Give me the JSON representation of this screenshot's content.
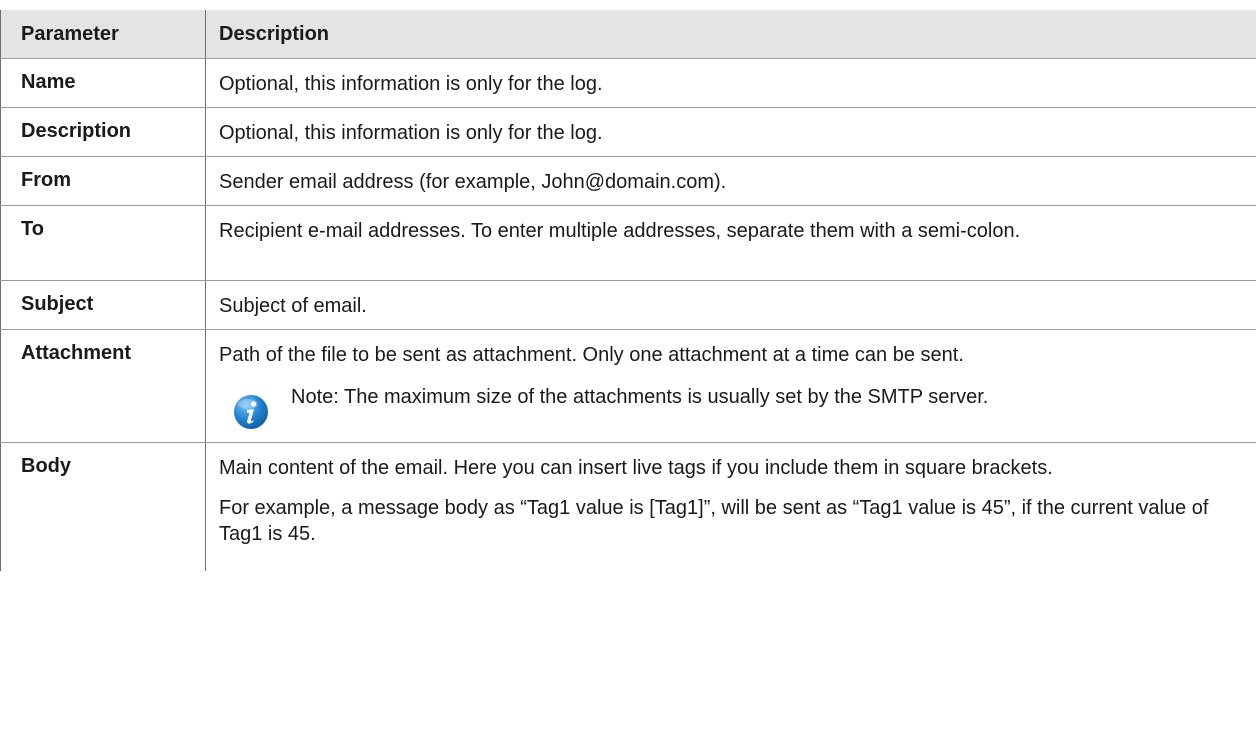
{
  "table": {
    "headers": {
      "parameter": "Parameter",
      "description": "Description"
    },
    "rows": [
      {
        "name": "Name",
        "description": "Optional, this information is only for the log."
      },
      {
        "name": "Description",
        "description": "Optional, this information is only for the log."
      },
      {
        "name": "From",
        "description": "Sender email address (for example, John@domain.com)."
      },
      {
        "name": "To",
        "description": "Recipient e-mail addresses. To enter multiple addresses, separate them with a semi-colon."
      },
      {
        "name": "Subject",
        "description": "Subject of email."
      },
      {
        "name": "Attachment",
        "description": "Path of the file to be sent as attachment. Only one attachment at a time can be sent.",
        "note": "Note: The maximum size of the attachments is usually set by the SMTP server.",
        "note_icon": "info-icon"
      },
      {
        "name": "Body",
        "description": "Main content of the email. Here you can insert live tags if you include them in square brackets.",
        "description2": "For example, a message body as “Tag1 value is [Tag1]”, will be sent as “Tag1 value is 45”, if the current value of Tag1 is 45."
      }
    ]
  },
  "colors": {
    "header_bg": "#e4e4e4",
    "info_icon": "#1f7bc8"
  }
}
